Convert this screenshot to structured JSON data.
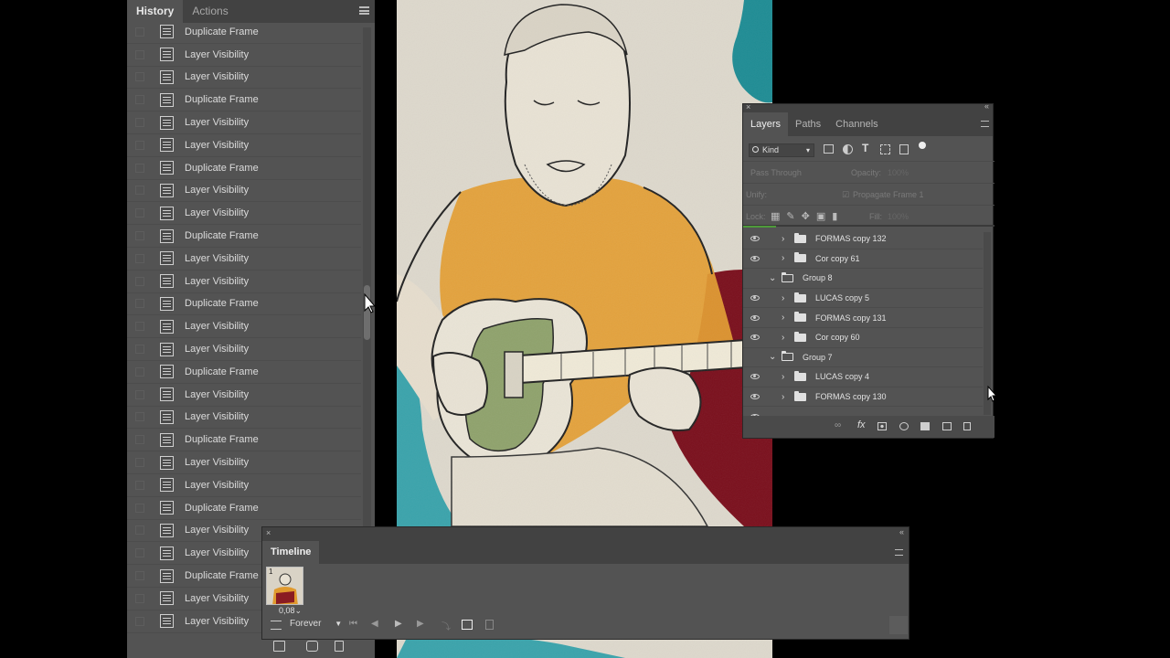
{
  "history_panel": {
    "tabs": [
      "History",
      "Actions"
    ],
    "items": [
      "Duplicate Frame",
      "Layer Visibility",
      "Layer Visibility",
      "Duplicate Frame",
      "Layer Visibility",
      "Layer Visibility",
      "Duplicate Frame",
      "Layer Visibility",
      "Layer Visibility",
      "Duplicate Frame",
      "Layer Visibility",
      "Layer Visibility",
      "Duplicate Frame",
      "Layer Visibility",
      "Layer Visibility",
      "Duplicate Frame",
      "Layer Visibility",
      "Layer Visibility",
      "Duplicate Frame",
      "Layer Visibility",
      "Layer Visibility",
      "Duplicate Frame",
      "Layer Visibility",
      "Layer Visibility",
      "Duplicate Frame",
      "Layer Visibility",
      "Layer Visibility"
    ]
  },
  "layers_panel": {
    "tabs": [
      "Layers",
      "Paths",
      "Channels"
    ],
    "filter_kind": "Kind",
    "blend_mode": "Pass Through",
    "opacity_label": "Opacity:",
    "opacity_value": "100%",
    "unify_label": "Unify:",
    "propagate_label": "Propagate Frame 1",
    "lock_label": "Lock:",
    "fill_label": "Fill:",
    "fill_value": "100%",
    "layers": [
      {
        "name": "FORMAS copy 132",
        "visible": true,
        "group": false,
        "indent": 1
      },
      {
        "name": "Cor copy 61",
        "visible": true,
        "group": false,
        "indent": 1
      },
      {
        "name": "Group 8",
        "visible": false,
        "group": true,
        "indent": 0
      },
      {
        "name": "LUCAS copy 5",
        "visible": true,
        "group": false,
        "indent": 1
      },
      {
        "name": "FORMAS copy 131",
        "visible": true,
        "group": false,
        "indent": 1
      },
      {
        "name": "Cor copy 60",
        "visible": true,
        "group": false,
        "indent": 1
      },
      {
        "name": "Group 7",
        "visible": false,
        "group": true,
        "indent": 0
      },
      {
        "name": "LUCAS copy 4",
        "visible": true,
        "group": false,
        "indent": 1
      },
      {
        "name": "FORMAS copy 130",
        "visible": true,
        "group": false,
        "indent": 1
      }
    ]
  },
  "timeline_panel": {
    "tab": "Timeline",
    "frame_number": "1",
    "frame_delay": "0,08",
    "loop_option": "Forever"
  },
  "colors": {
    "panel_bg": "#535353",
    "tab_bg": "#424242",
    "shirt": "#e09a2e",
    "guitar": "#8c9e6a",
    "teal": "#1e8c94",
    "maroon": "#6b1018"
  }
}
